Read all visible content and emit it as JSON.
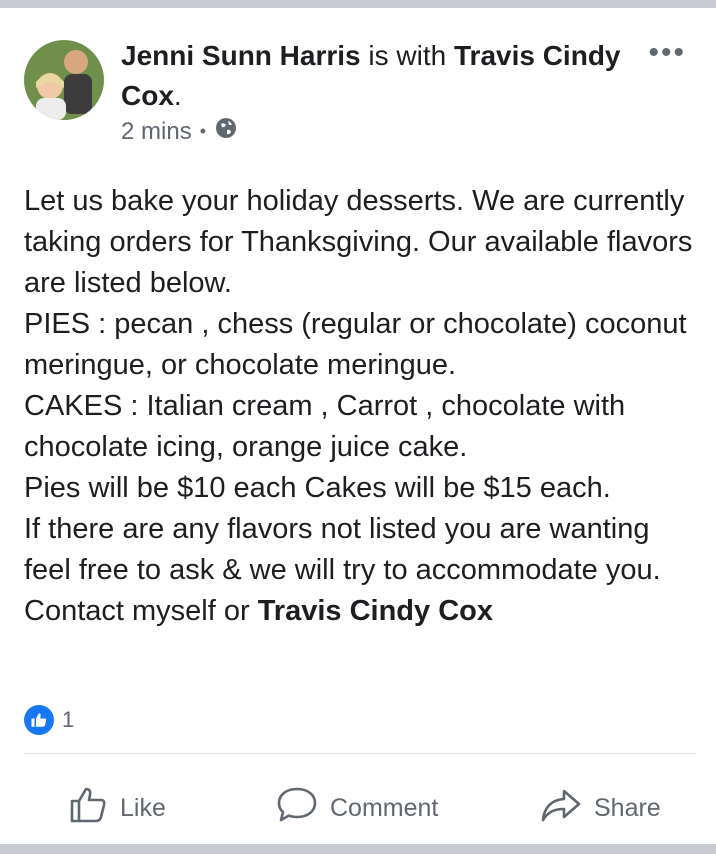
{
  "post": {
    "author": "Jenni Sunn Harris",
    "with_text": " is with ",
    "tagged": "Travis Cindy Cox",
    "period": ".",
    "time": "2 mins",
    "privacy_icon": "globe-icon",
    "body_main": "Let us bake your holiday desserts. We are currently taking orders for Thanksgiving. Our available flavors are listed below.\nPIES : pecan , chess (regular or chocolate) coconut meringue, or chocolate meringue.\nCAKES : Italian cream , Carrot , chocolate with chocolate icing, orange juice cake.\nPies will be $10 each Cakes will be $15 each.\nIf there are any flavors not listed you are wanting feel free to ask & we will try to accommodate you. Contact myself or ",
    "body_tag": "Travis Cindy Cox",
    "reaction_count": "1"
  },
  "actions": {
    "like": "Like",
    "comment": "Comment",
    "share": "Share"
  },
  "colors": {
    "accent": "#1877f2",
    "secondary_text": "#606770",
    "background": "#c9ccd1"
  }
}
